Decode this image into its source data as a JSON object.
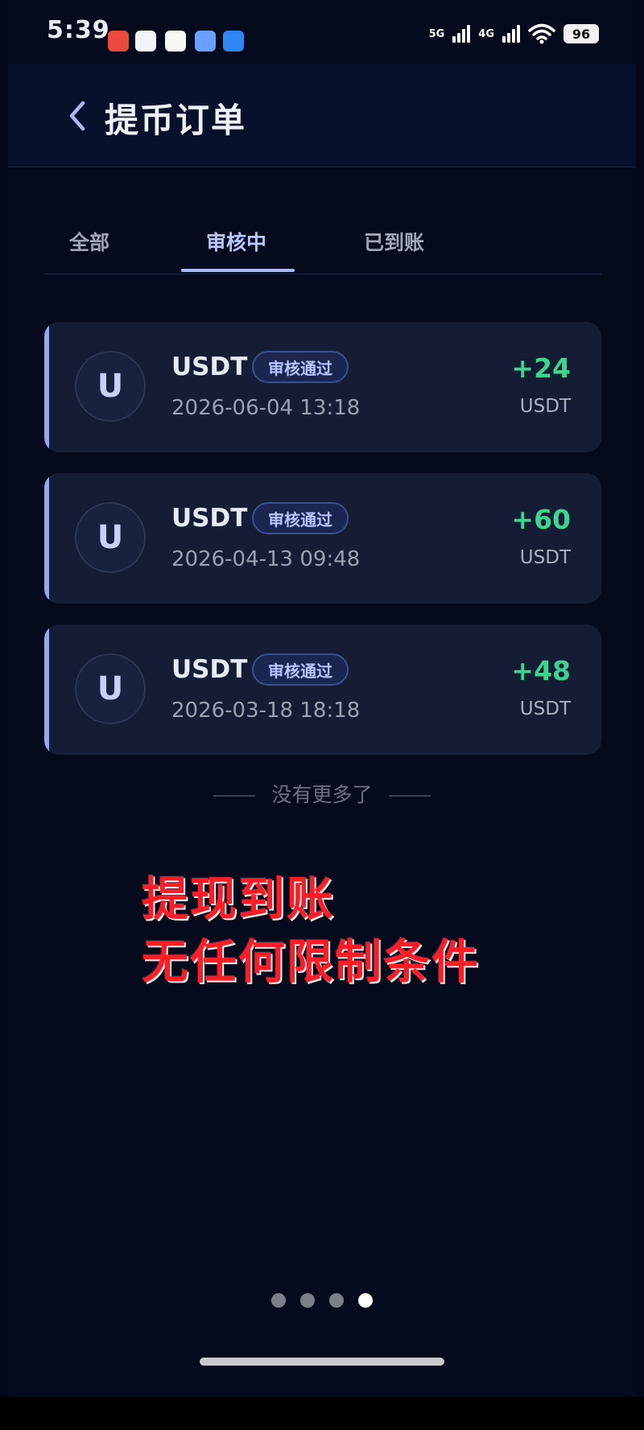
{
  "status_bar": {
    "time": "5:39",
    "net_5g": "5G",
    "net_4g": "4G",
    "battery": "96"
  },
  "header": {
    "title": "提币订单"
  },
  "tabs": [
    {
      "label": "全部"
    },
    {
      "label": "审核中"
    },
    {
      "label": "已到账"
    }
  ],
  "orders": [
    {
      "avatar": "U",
      "coin": "USDT",
      "status": "审核通过",
      "time": "2026-06-04 13:18",
      "amount": "+24",
      "unit": "USDT"
    },
    {
      "avatar": "U",
      "coin": "USDT",
      "status": "审核通过",
      "time": "2026-04-13 09:48",
      "amount": "+60",
      "unit": "USDT"
    },
    {
      "avatar": "U",
      "coin": "USDT",
      "status": "审核通过",
      "time": "2026-03-18 18:18",
      "amount": "+48",
      "unit": "USDT"
    }
  ],
  "list_end": "没有更多了",
  "overlay": {
    "line1": "提现到账",
    "line2": "无任何限制条件"
  },
  "colors": {
    "background": "#050a1c",
    "card": "#141d33",
    "accent": "#9aa7f0",
    "amount_green": "#3ed38e",
    "overlay_red": "#ff1c24"
  }
}
